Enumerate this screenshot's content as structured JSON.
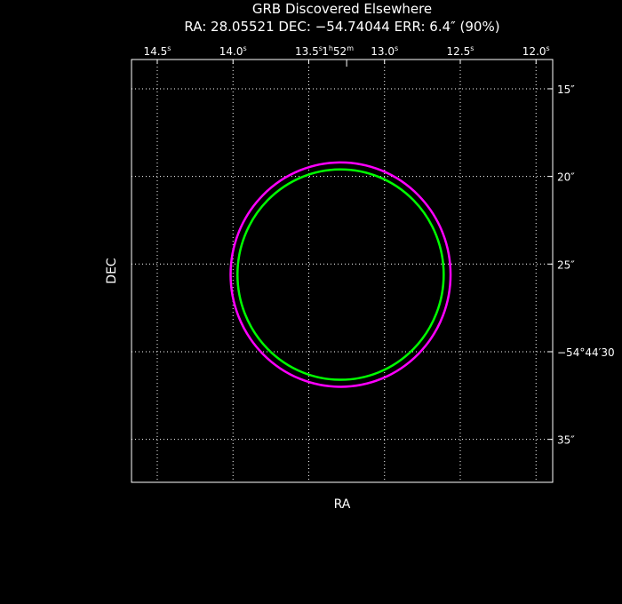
{
  "chart_data": {
    "type": "scatter",
    "title": "GRB Discovered Elsewhere",
    "subtitle": "RA: 28.05521   DEC: −54.74044   ERR: 6.4″ (90%)",
    "xlabel": "RA",
    "ylabel": "DEC",
    "x_unit": "seconds of RA (1h52m)",
    "y_unit": "arcseconds of DEC (−54°44′)",
    "xlim": [
      14.67,
      11.89
    ],
    "ylim": [
      37.45,
      13.33
    ],
    "grid": true,
    "x_ticks": [
      {
        "value": 14.5,
        "label": "14.5",
        "unit": "s"
      },
      {
        "value": 14.0,
        "label": "14.0",
        "unit": "s"
      },
      {
        "value": 13.5,
        "label": "13.5",
        "unit": "s"
      },
      {
        "value": 13.25,
        "label": "1",
        "label_h": "h",
        "label_mid": "52",
        "label_m": "m",
        "is_major": true
      },
      {
        "value": 13.0,
        "label": "13.0",
        "unit": "s"
      },
      {
        "value": 12.5,
        "label": "12.5",
        "unit": "s"
      },
      {
        "value": 12.0,
        "label": "12.0",
        "unit": "s"
      }
    ],
    "y_ticks": [
      {
        "value": 15,
        "label": "15",
        "unit": "″"
      },
      {
        "value": 20,
        "label": "20",
        "unit": "″"
      },
      {
        "value": 25,
        "label": "25",
        "unit": "″"
      },
      {
        "value": 30,
        "label": "−54°44′30",
        "unit": ""
      },
      {
        "value": 35,
        "label": "35",
        "unit": "″"
      }
    ],
    "circles": [
      {
        "name": "outer-error-circle",
        "ra_s": 13.29,
        "dec_as": 25.6,
        "radius_as": 6.4,
        "color": "#ff00ff"
      },
      {
        "name": "inner-error-circle",
        "ra_s": 13.29,
        "dec_as": 25.6,
        "radius_as": 6.0,
        "color": "#00ff00"
      }
    ]
  }
}
